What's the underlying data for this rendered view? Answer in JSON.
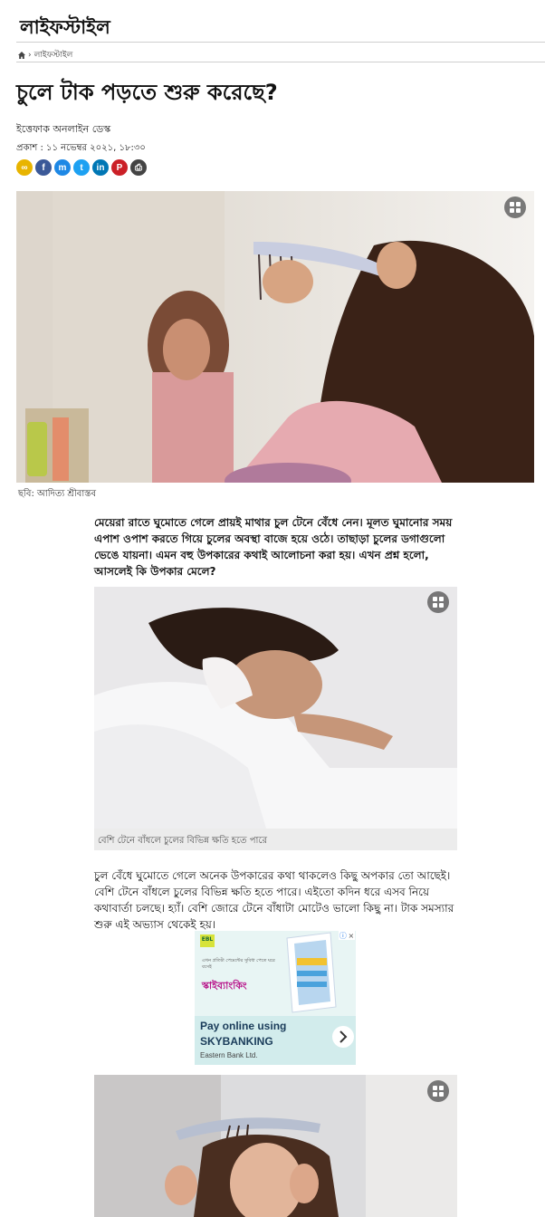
{
  "section": {
    "title": "লাইফস্টাইল"
  },
  "breadcrumb": {
    "home_icon": "home-icon",
    "separator": "›",
    "current": "লাইফস্টাইল"
  },
  "article": {
    "headline": "চুলে টাক পড়তে শুরু করেছে?",
    "author": "ইত্তেফাক অনলাইন ডেস্ক",
    "published": "প্রকাশ : ১১ নভেম্বর ২০২১, ১৮:৩০",
    "hero_caption": "ছবি: আদিত্য শ্রীবাস্তব",
    "intro": "মেয়েরা রাতে ঘুমোতে গেলে প্রায়ই মাথার চুল টেনে বেঁধে নেন। মূলত ঘুমানোর সময় এপাশ ওপাশ করতে গিয়ে চুলের অবস্থা বাজে হয়ে ওঠে। তাছাড়া চুলের ডগাগুলো ভেঙে যায়না। এমন বহু উপকারের কথাই আলোচনা করা হয়। এখন প্রশ্ন হলো, আসলেই কি উপকার মেলে?",
    "image2_caption": "বেশি টেনে বাঁধলে চুলের বিভিন্ন ক্ষতি হতে পারে",
    "body1": "চুল বেঁধে ঘুমোতে গেলে অনেক উপকারের কথা থাকলেও কিছু অপকার তো আছেই। বেশি টেনে বাঁধলে চুলের বিভিন্ন ক্ষতি হতে পারে। এইতো কদিন ধরে এসব নিয়ে কথাবার্তা চলছে। হ্যাঁ। বেশি জোরে টেনে বাঁধাটা মোটেও ভালো কিছু না। টাক সমস্যার শুরু এই অভ্যাস থেকেই হয়।"
  },
  "share_icons": [
    {
      "name": "link-icon",
      "glyph": "∞",
      "color": "#e8b400"
    },
    {
      "name": "facebook-icon",
      "glyph": "f",
      "color": "#3b5998"
    },
    {
      "name": "messenger-icon",
      "glyph": "m",
      "color": "#1e88e5"
    },
    {
      "name": "twitter-icon",
      "glyph": "t",
      "color": "#1da1f2"
    },
    {
      "name": "linkedin-icon",
      "glyph": "in",
      "color": "#0077b5"
    },
    {
      "name": "pinterest-icon",
      "glyph": "P",
      "color": "#cb2027"
    },
    {
      "name": "print-icon",
      "glyph": "⎙",
      "color": "#444444"
    }
  ],
  "ad": {
    "brand_badge": "EBL",
    "bangla_line": "এখন প্রতিটা পেমেন্টের সুবিধা পেতে ঘরে বসেই",
    "brand_bn": "স্কাইব্যাংকিং",
    "headline": "Pay online using",
    "brand": "SKYBANKING",
    "bank": "Eastern Bank Ltd.",
    "info_icon": "info-icon",
    "close_icon": "close-icon"
  }
}
